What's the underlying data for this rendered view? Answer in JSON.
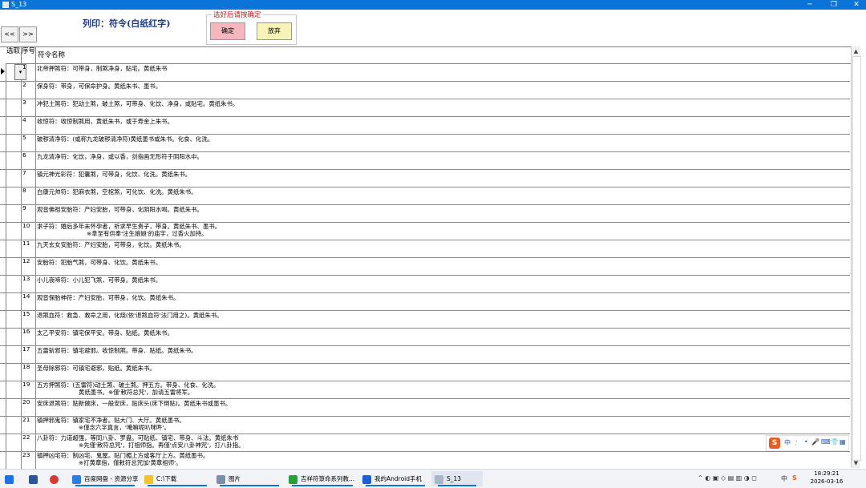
{
  "window": {
    "title": "S_13",
    "controls": [
      "─",
      "❐",
      "✕"
    ]
  },
  "nav": {
    "prev_label": "<<",
    "next_label": ">>"
  },
  "heading": "列印：符令(白纸红字)",
  "confirm_group": {
    "legend": "选好后请按确定",
    "confirm_label": "确定",
    "discard_label": "放弃"
  },
  "columns": {
    "select": "选取",
    "number": "序号",
    "name": "符令名称"
  },
  "rows": [
    {
      "num": "1",
      "text": "北帝押煞符：可带身，制煞净身，贴宅。黄纸朱书"
    },
    {
      "num": "2",
      "text": "保身符：带身，可保命护身。黄纸朱书、墨书。"
    },
    {
      "num": "3",
      "text": "冲犯土煞符：犯动土煞，破土煞，可带身、化饮、净身，或贴宅。黄纸朱书。"
    },
    {
      "num": "4",
      "text": "收惊符：收惊制煞用，黄纸朱书，或于寿金上朱书。"
    },
    {
      "num": "5",
      "text": "破秽清净符：(或称九龙破秽清净符)黄纸墨书或朱书。化食、化洗。"
    },
    {
      "num": "6",
      "text": "九龙清净符：化饮，净身，或以香，剑指画无形符于阴阳水中。"
    },
    {
      "num": "7",
      "text": "镇元神光彩符：犯囊煞，可带身，化饮、化洗。黄纸朱书。"
    },
    {
      "num": "8",
      "text": "白康元帅符：犯麻衣煞，空棺煞，可化饮、化洗。黄纸朱书。"
    },
    {
      "num": "9",
      "text": "观音佛祖安胎符：产妇安胎，可带身，化阴阳水喝。黄纸朱书。"
    },
    {
      "num": "10",
      "text": "求子符：婚后多年未怀孕者，祈求早生贵子，带身。黄纸朱书、墨书。",
      "text2": "※拿至有供奉'注生娘娘'的庙宇，过香火加持。"
    },
    {
      "num": "11",
      "text": "九天玄女安胎符：产妇安胎，可带身，化饮。黄纸朱书。"
    },
    {
      "num": "12",
      "text": "安胎符：犯胎气煞，可带身、化饮。黄纸朱书。"
    },
    {
      "num": "13",
      "text": "小儿夜啼符：小儿犯飞煞，可带身。黄纸朱书。"
    },
    {
      "num": "14",
      "text": "观音保胎神符：产妇安胎，可带身，化饮。黄纸朱书。"
    },
    {
      "num": "15",
      "text": "退煞血符：救急、救命之用，化烧(依'退煞血符'法门用之)。黄纸朱书。"
    },
    {
      "num": "16",
      "text": "太乙平安符：镇宅保平安。带身、贴纸。黄纸朱书。"
    },
    {
      "num": "17",
      "text": "五雷斩邪符：镇宅避邪。收惊制煞。带身、贴纸。黄纸朱书。"
    },
    {
      "num": "18",
      "text": "圣母除邪符：可镇宅避邪，贴纸。黄纸朱书。"
    },
    {
      "num": "19",
      "text": "五方押煞符：(五雷符)动土煞、破土煞。押五方。带身、化食、化洗。",
      "text2": "黄纸墨书。※僅'敕符总咒'，加请五雷将军。"
    },
    {
      "num": "20",
      "text": "安床退煞符：贴新做床，一般安床，贴床头(床下倒贴)。黄纸朱书或墨书。"
    },
    {
      "num": "21",
      "text": "镇押邪鬼符：镇家宅不净者。贴大门、大厅。黄纸墨书。",
      "text2": "※僅念六字真言，'唵嘛呢叭咪吽'。"
    },
    {
      "num": "22",
      "text": "八卦符：力道超强，等同八卦、罗盘。可贴纸、镇宅、带身、斗法。黄纸朱书",
      "text2": "※先僅'敕符总咒'，打祖师指。再僅'点安八卦神咒'，打八卦指。"
    },
    {
      "num": "23",
      "text": "镇押凶宅符：制凶宅、鬼屋。贴门楣上方或客厅上方。黄纸墨书。",
      "text2": "※打黄章指，僅敕符总咒加'黄章祖师'。"
    }
  ],
  "ime": {
    "logo": "S",
    "lang": "中",
    "icons": [
      "·̣",
      "•",
      "🎤",
      "⌨",
      "👕",
      "▦"
    ]
  },
  "taskbar": {
    "items": [
      {
        "label": "百度网盘 - 资源分享",
        "color": "#2f7de1"
      },
      {
        "label": "C:\\下载",
        "color": "#f2c230"
      },
      {
        "label": "图片",
        "color": "#7a8fa8"
      },
      {
        "label": "吉祥符箓命系列教...",
        "color": "#2a9d3f"
      },
      {
        "label": "我的Android手机",
        "color": "#1c5fd6"
      },
      {
        "label": "S_13",
        "color": "#aab6c8"
      }
    ],
    "tray_lang": "中",
    "time": "18:29:21",
    "date": "2026-03-16"
  }
}
